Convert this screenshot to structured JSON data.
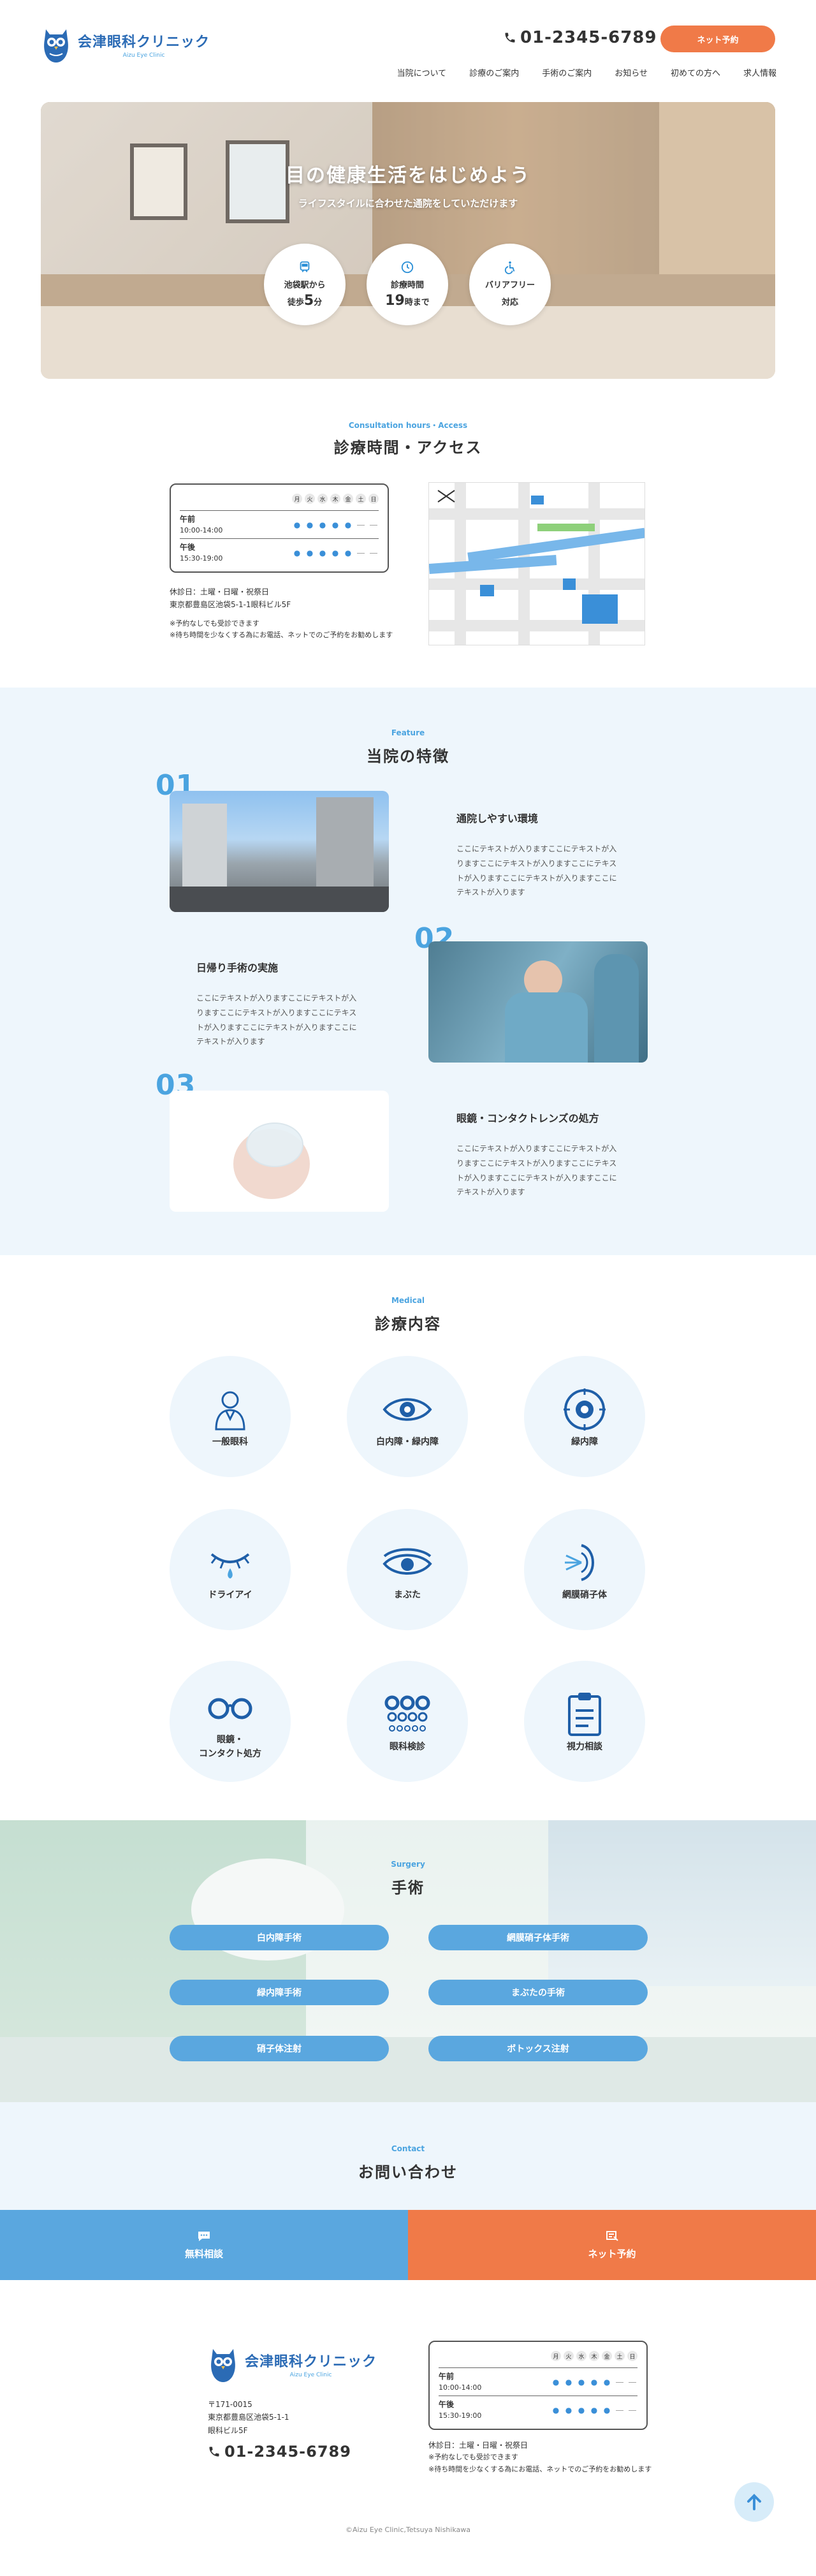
{
  "header": {
    "logo_name": "会津眼科クリニック",
    "logo_sub": "Aizu Eye Clinic",
    "tel": "01-2345-6789",
    "reserve": "ネット予約",
    "nav": [
      "当院について",
      "診療のご案内",
      "手術のご案内",
      "お知らせ",
      "初めての方へ",
      "求人情報"
    ]
  },
  "hero": {
    "title": "目の健康生活をはじめよう",
    "subtitle": "ライフスタイルに合わせた通院をしていただけます",
    "badges": [
      {
        "icon": "train-icon",
        "l1": "池袋駅から",
        "l2a": "徒歩",
        "l2b": "5",
        "l2c": "分"
      },
      {
        "icon": "clock-icon",
        "l1": "診療時間",
        "l2a": "",
        "l2b": "19",
        "l2c": "時まで"
      },
      {
        "icon": "wheelchair-icon",
        "l1": "バリアフリー",
        "l2a": "対応",
        "l2b": "",
        "l2c": ""
      }
    ]
  },
  "access": {
    "en": "Consultation hours・Access",
    "ja": "診療時間・アクセス"
  },
  "schedule": {
    "days": [
      "月",
      "火",
      "水",
      "木",
      "金",
      "土",
      "日"
    ],
    "rows": [
      {
        "label": "午前",
        "time": "10:00-14:00",
        "marks": [
          "●",
          "●",
          "●",
          "●",
          "●",
          "―",
          "―"
        ]
      },
      {
        "label": "午後",
        "time": "15:30-19:00",
        "marks": [
          "●",
          "●",
          "●",
          "●",
          "●",
          "―",
          "―"
        ]
      }
    ],
    "closed": "休診日：土曜・日曜・祝祭日",
    "address": "東京都豊島区池袋5-1-1眼科ビル5F",
    "note1": "※予約なしでも受診できます",
    "note2": "※待ち時間を少なくする為にお電話、ネットでのご予約をお勧めします"
  },
  "features": {
    "en": "Feature",
    "ja": "当院の特徴",
    "items": [
      {
        "num": "01",
        "title": "通院しやすい環境",
        "text": "ここにテキストが入りますここにテキストが入りますここにテキストが入りますここにテキストが入りますここにテキストが入りますここにテキストが入ります"
      },
      {
        "num": "02",
        "title": "日帰り手術の実施",
        "text": "ここにテキストが入りますここにテキストが入りますここにテキストが入りますここにテキストが入りますここにテキストが入りますここにテキストが入ります"
      },
      {
        "num": "03",
        "title": "眼鏡・コンタクトレンズの処方",
        "text": "ここにテキストが入りますここにテキストが入りますここにテキストが入りますここにテキストが入りますここにテキストが入りますここにテキストが入ります"
      }
    ]
  },
  "medical": {
    "en": "Medical",
    "ja": "診療内容",
    "items": [
      {
        "icon": "doctor-icon",
        "label": "一般眼科"
      },
      {
        "icon": "eye-icon",
        "label": "白内障・緑内障"
      },
      {
        "icon": "eyeball-icon",
        "label": "緑内障"
      },
      {
        "icon": "tear-eye-icon",
        "label": "ドライアイ"
      },
      {
        "icon": "eyelid-icon",
        "label": "まぶた"
      },
      {
        "icon": "vitreous-icon",
        "label": "網膜硝子体"
      },
      {
        "icon": "glasses-icon",
        "label": "眼鏡・\nコンタクト処方"
      },
      {
        "icon": "eye-chart-icon",
        "label": "眼科検診"
      },
      {
        "icon": "clipboard-icon",
        "label": "視力相談"
      }
    ]
  },
  "surgery": {
    "en": "Surgery",
    "ja": "手術",
    "items": [
      "白内障手術",
      "網膜硝子体手術",
      "緑内障手術",
      "まぶたの手術",
      "硝子体注射",
      "ボトックス注射"
    ]
  },
  "contact": {
    "en": "Contact",
    "ja": "お問い合わせ",
    "free": "無料相談",
    "net": "ネット予約"
  },
  "footer": {
    "zip": "〒171-0015",
    "addr1": "東京都豊島区池袋5-1-1",
    "addr2": "眼科ビル5F",
    "tel": "01-2345-6789",
    "copyright": "©Aizu Eye Clinic,Tetsuya Nishikawa"
  },
  "colors": {
    "primary": "#4ba4e0",
    "accent": "#f07a48",
    "navy": "#2b6bb5"
  }
}
